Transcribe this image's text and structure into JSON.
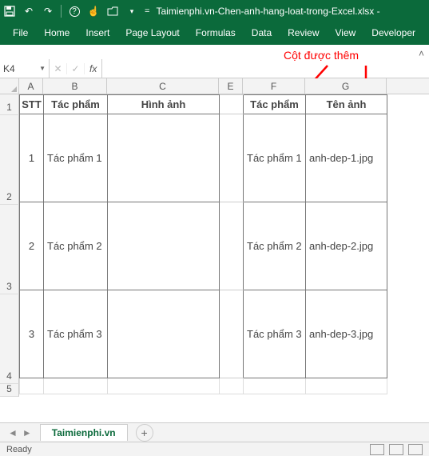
{
  "titlebar": {
    "filename": "Taimienphi.vn-Chen-anh-hang-loat-trong-Excel.xlsx -"
  },
  "ribbon": {
    "tabs": [
      "File",
      "Home",
      "Insert",
      "Page Layout",
      "Formulas",
      "Data",
      "Review",
      "View",
      "Developer"
    ]
  },
  "formula_bar": {
    "name_box": "K4",
    "fx_label": "fx",
    "value": ""
  },
  "annotation": {
    "text": "Cột được thêm"
  },
  "columns": {
    "A": "A",
    "B": "B",
    "C": "C",
    "E": "E",
    "F": "F",
    "G": "G"
  },
  "row_numbers": [
    "1",
    "2",
    "3",
    "4",
    "5"
  ],
  "headers": {
    "stt": "STT",
    "tacpham": "Tác phẩm",
    "hinhanh": "Hình ảnh",
    "tacpham2": "Tác phẩm",
    "tenanh": "Tên ảnh"
  },
  "rows": [
    {
      "stt": "1",
      "tp": "Tác phẩm 1",
      "img": "",
      "tp2": "Tác phẩm 1",
      "ten": "anh-dep-1.jpg"
    },
    {
      "stt": "2",
      "tp": "Tác phẩm 2",
      "img": "",
      "tp2": "Tác phẩm 2",
      "ten": "anh-dep-2.jpg"
    },
    {
      "stt": "3",
      "tp": "Tác phẩm 3",
      "img": "",
      "tp2": "Tác phẩm 3",
      "ten": "anh-dep-3.jpg"
    }
  ],
  "sheet_tab": {
    "name": "Taimienphi.vn"
  },
  "statusbar": {
    "ready": "Ready"
  }
}
